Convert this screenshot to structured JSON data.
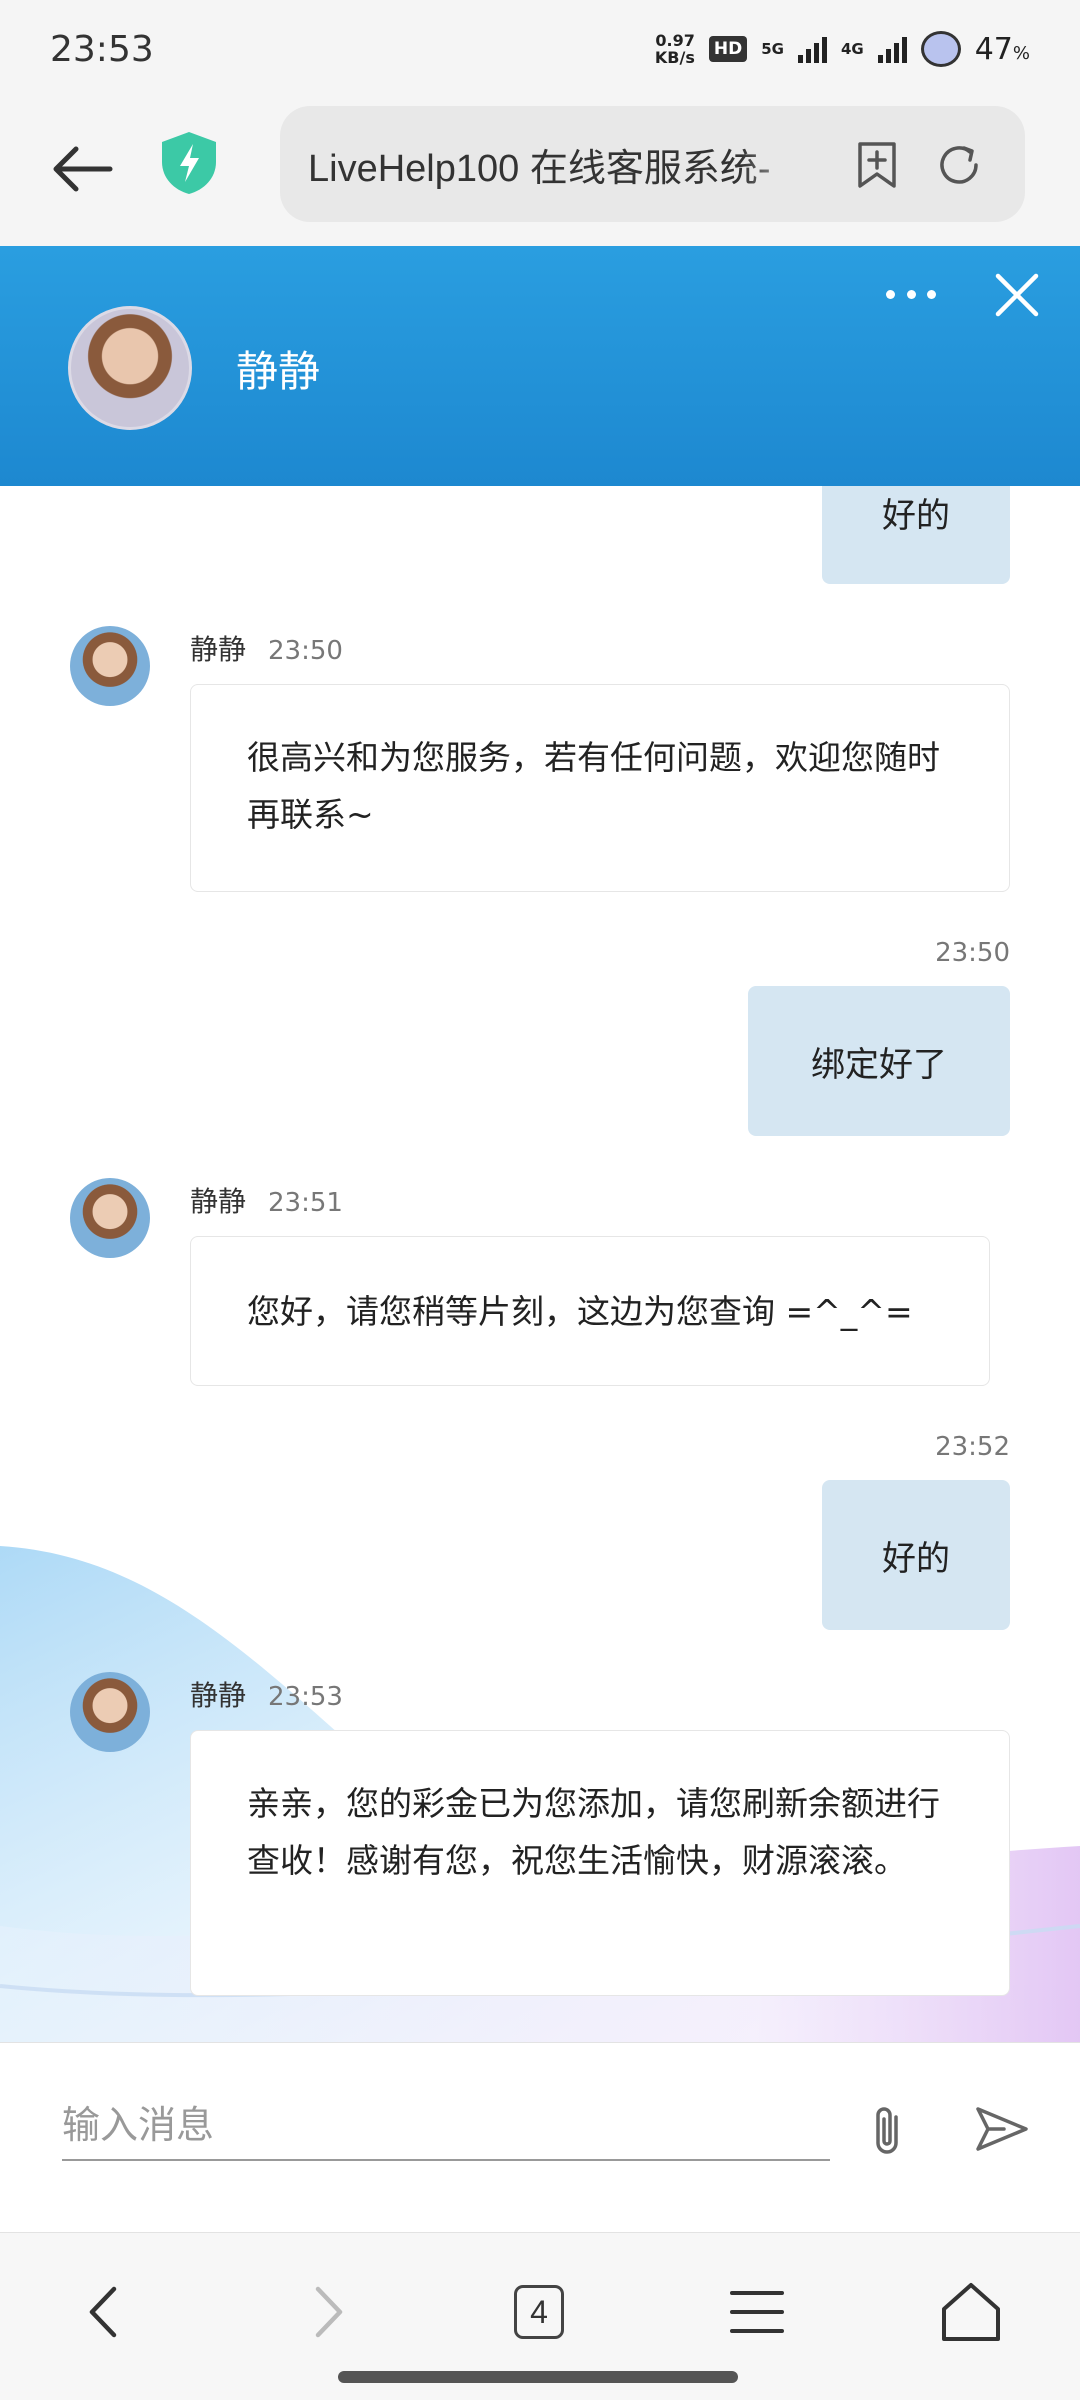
{
  "status_bar": {
    "time": "23:53",
    "net_speed_value": "0.97",
    "net_speed_unit": "KB/s",
    "hd": "HD",
    "net1": "5G",
    "net2": "4G",
    "battery": "47",
    "battery_unit": "%"
  },
  "browser": {
    "url_title": "LiveHelp100 在线客服系统-"
  },
  "chat": {
    "agent_name": "静静",
    "messages": [
      {
        "side": "right",
        "text": "好的"
      },
      {
        "side": "left",
        "name": "静静",
        "time": "23:50",
        "text": "很高兴和为您服务，若有任何问题，欢迎您随时再联系~"
      },
      {
        "side": "right",
        "time": "23:50",
        "text": "绑定好了"
      },
      {
        "side": "left",
        "name": "静静",
        "time": "23:51",
        "text": "您好，请您稍等片刻，这边为您查询 =^_^="
      },
      {
        "side": "right",
        "time": "23:52",
        "text": "好的"
      },
      {
        "side": "left",
        "name": "静静",
        "time": "23:53",
        "text": "亲亲，您的彩金已为您添加，请您刷新余额进行查收！感谢有您，祝您生活愉快，财源滚滚。"
      }
    ]
  },
  "input": {
    "placeholder": "输入消息"
  },
  "bottom_nav": {
    "tab_count": "4"
  },
  "colors": {
    "header_blue": "#1d88d0",
    "bubble_right": "#d5e6f2",
    "shield_green": "#3cc9a6"
  }
}
